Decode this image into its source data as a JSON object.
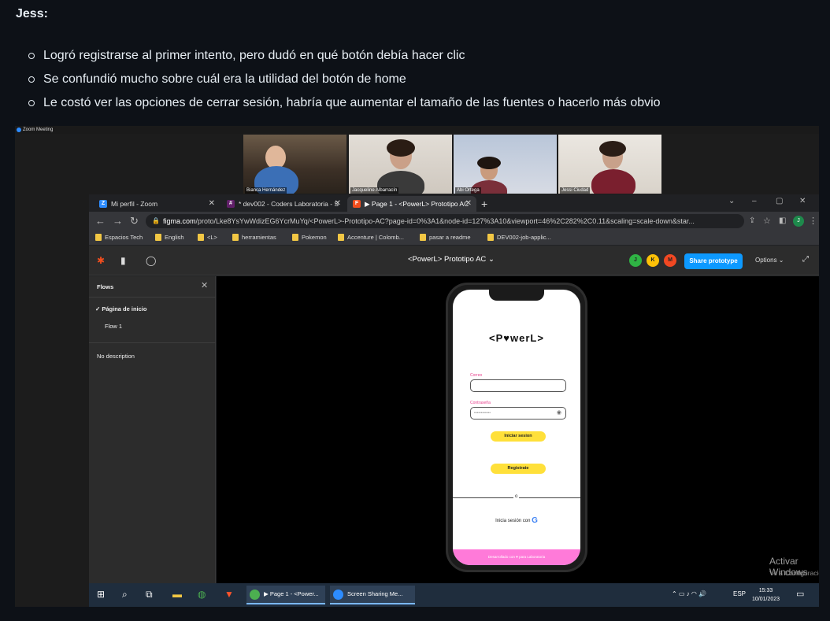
{
  "note": {
    "title": "Jess:",
    "bullets": [
      "Logró registrarse al primer intento, pero dudó en qué botón debía hacer clic",
      "Se confundió mucho sobre cuál era la utilidad del botón de home",
      "Le costó ver las opciones de cerrar sesión, habría que aumentar el tamaño de las fuentes o hacerlo más obvio"
    ]
  },
  "zoom": {
    "window_title": "Zoom Meeting",
    "participants": [
      "Bianca Hernández",
      "Jacqueline Albarracín",
      "Abi Ortega",
      "Jessi Ciudad"
    ]
  },
  "browser": {
    "tabs": [
      {
        "label": "Mi perfil - Zoom"
      },
      {
        "label": "* dev002 - Coders Laboratoria - S"
      },
      {
        "label": "▶ Page 1 - <PowerL> Prototipo AC"
      }
    ],
    "new_tab": "+",
    "window_controls": [
      "⌄",
      "–",
      "▢",
      "✕"
    ],
    "url_domain": "figma.com",
    "url_path": "/proto/Lke8YsYwWdizEG6YcrMuYq/<PowerL>-Prototipo-AC?page-id=0%3A1&node-id=127%3A10&viewport=46%2C282%2C0.11&scaling=scale-down&star...",
    "bookmarks": [
      "Espacios Tech",
      "English",
      "<L>",
      "herramientas",
      "Pokemon",
      "Accenture | Colomb...",
      "pasar a readme",
      "DEV002-job-applic..."
    ]
  },
  "figma": {
    "title": "<PowerL> Prototipo AC",
    "avatars": [
      {
        "letter": "J",
        "color": "#2fb344"
      },
      {
        "letter": "K",
        "color": "#ffc107"
      },
      {
        "letter": "M",
        "color": "#f24822"
      }
    ],
    "share_label": "Share prototype",
    "options_label": "Options ⌄",
    "sidebar": {
      "heading": "Flows",
      "page": "Página de inicio",
      "flow": "Flow 1",
      "description": "No description"
    }
  },
  "app": {
    "logo": "<P♥werL>",
    "email_label": "Correo",
    "password_label": "Contraseña",
    "password_value": "••••••••••••",
    "login_button": "Iniciar sesion",
    "register_button": "Registrate",
    "divider_text": "o",
    "google_text": "Inicia sesión con",
    "footer": "Desarrollado con ♥ para Laboratoria"
  },
  "windows": {
    "activate_title": "Activar Windows",
    "activate_sub": "Ve a Configuración para activar Windows.",
    "taskbar_apps": [
      "▶ Page 1 - <Power...",
      "Screen Sharing Me..."
    ],
    "lang": "ESP",
    "time": "15:33",
    "date": "10/01/2023"
  }
}
